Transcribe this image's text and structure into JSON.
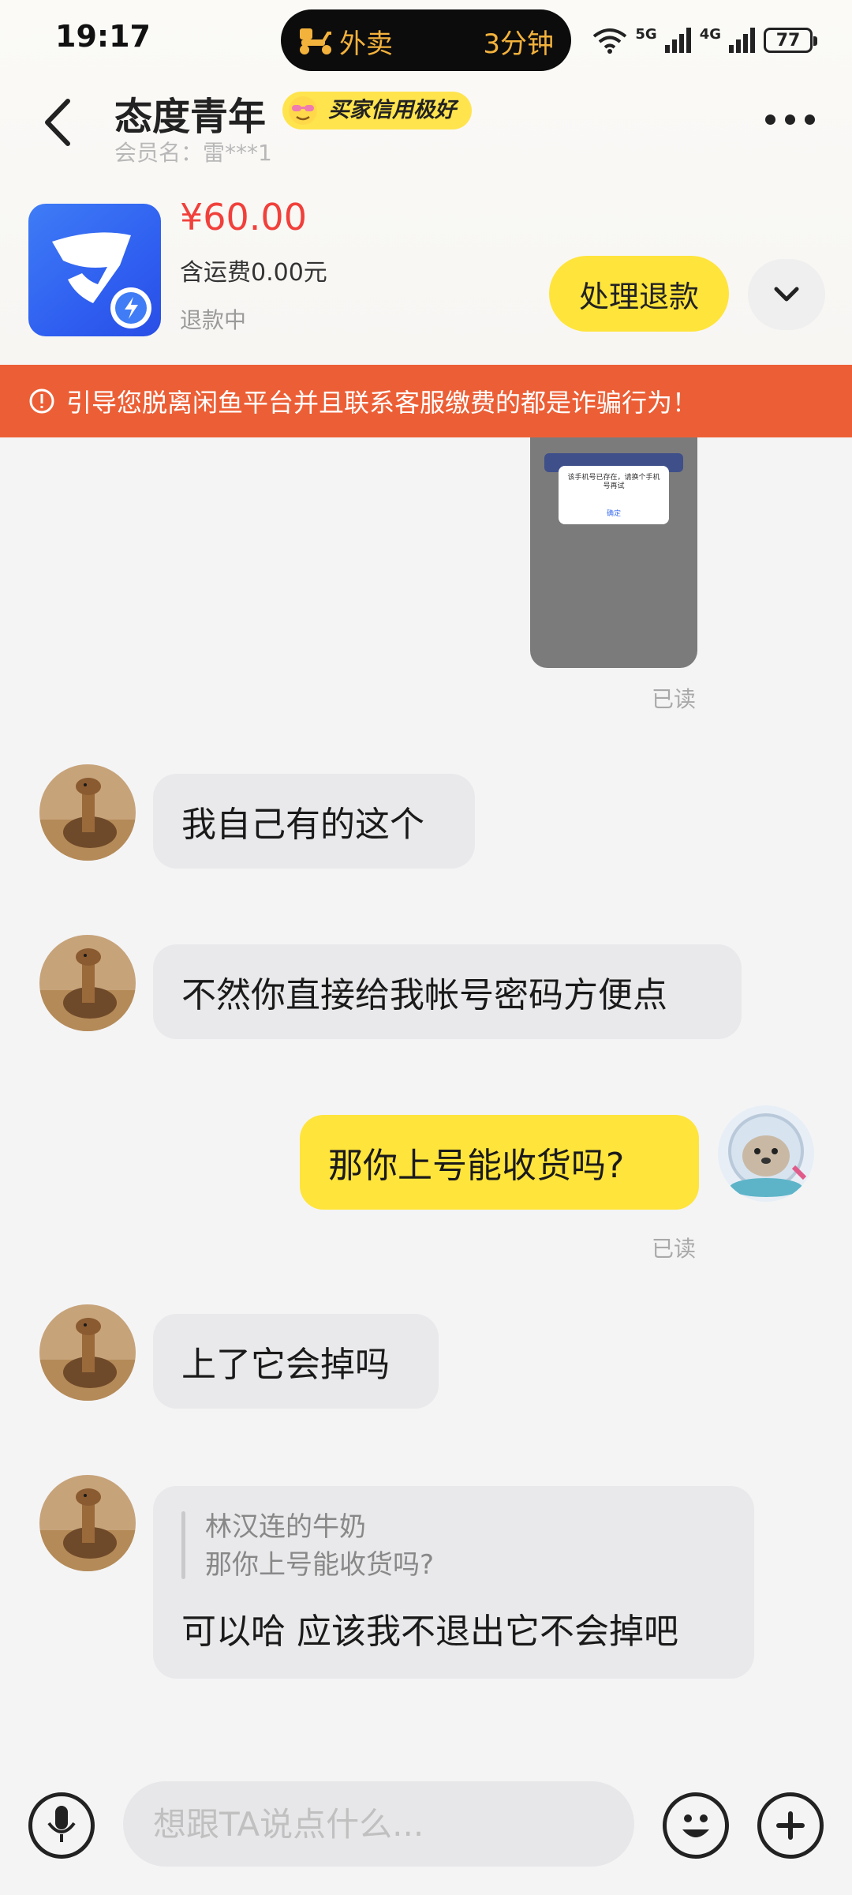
{
  "status_bar": {
    "time": "19:17",
    "delivery_label": "外卖",
    "delivery_time": "3分钟",
    "network_5g": "5G",
    "network_4g": "4G",
    "battery": "77"
  },
  "header": {
    "name": "态度青年",
    "badge": "买家信用极好",
    "member": "会员名：雷***1"
  },
  "product": {
    "price": "¥60.00",
    "shipping": "含运费0.00元",
    "status": "退款中",
    "refund_button": "处理退款"
  },
  "warning": "引导您脱离闲鱼平台并且联系客服缴费的都是诈骗行为！",
  "screenshot_dialog": {
    "text": "该手机号已存在，请换个手机号再试",
    "ok": "确定"
  },
  "messages": [
    {
      "side": "other",
      "text": "我自己有的这个"
    },
    {
      "side": "other",
      "text": "不然你直接给我帐号密码方便点"
    },
    {
      "side": "mine",
      "text": "那你上号能收货吗?"
    },
    {
      "side": "other",
      "text": "上了它会掉吗"
    },
    {
      "side": "other",
      "quote_name": "林汉连的牛奶",
      "quote_text": "那你上号能收货吗?",
      "text": "可以哈 应该我不退出它不会掉吧"
    }
  ],
  "read_label": "已读",
  "input": {
    "placeholder": "想跟TA说点什么..."
  },
  "colors": {
    "accent_yellow": "#ffe43c",
    "warning_orange": "#ec5f36",
    "price_red": "#f1403b"
  }
}
